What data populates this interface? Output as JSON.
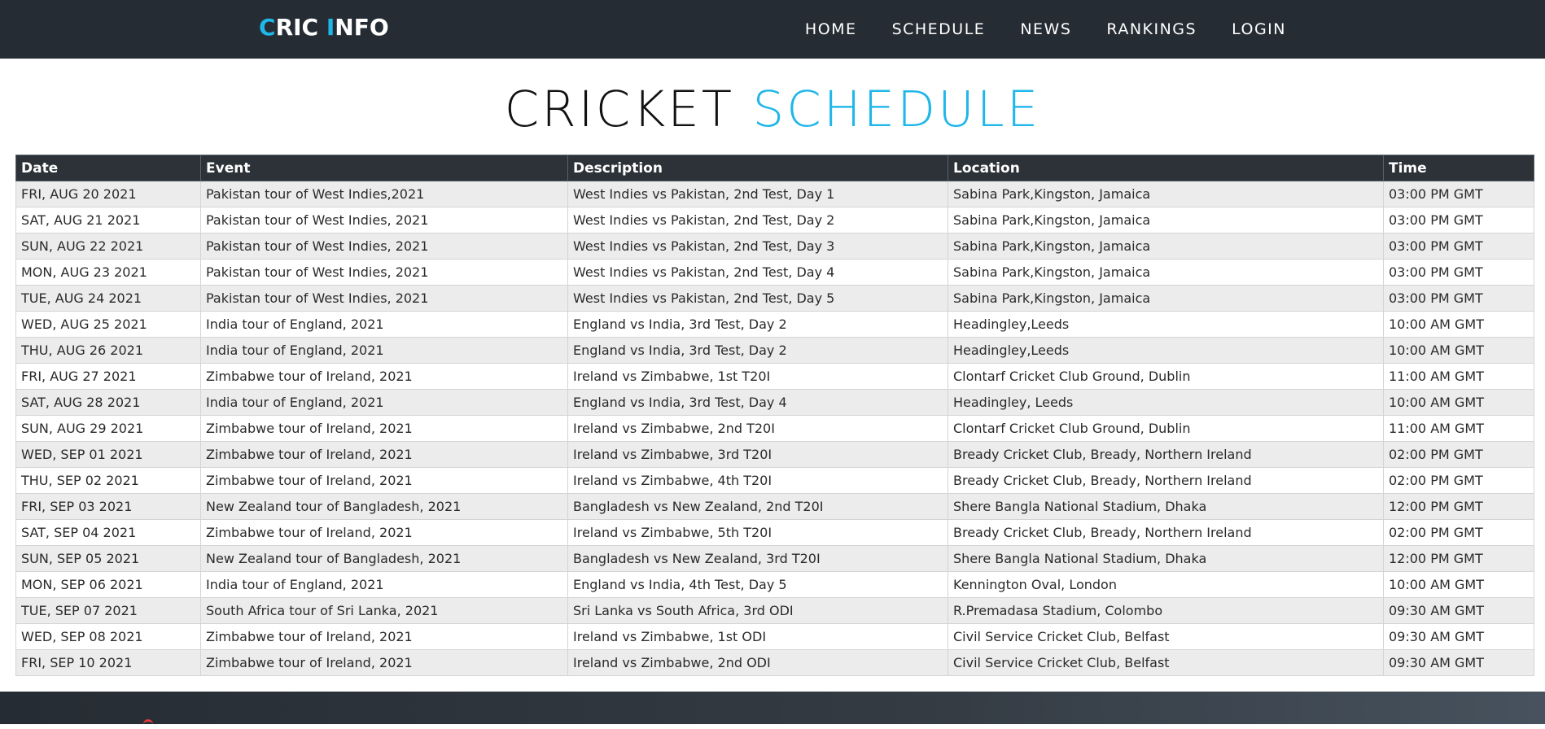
{
  "brand": {
    "part1_accent": "C",
    "part1_rest": "RIC ",
    "part2_accent": "I",
    "part2_rest": "NFO"
  },
  "nav": {
    "items": [
      {
        "label": "HOME"
      },
      {
        "label": "SCHEDULE"
      },
      {
        "label": "NEWS"
      },
      {
        "label": "RANKINGS"
      },
      {
        "label": "LOGIN"
      }
    ]
  },
  "page": {
    "title_part1": "CRICKET",
    "title_part2": "SCHEDULE"
  },
  "table": {
    "headers": [
      "Date",
      "Event",
      "Description",
      "Location",
      "Time"
    ],
    "rows": [
      [
        "FRI, AUG 20 2021",
        "Pakistan tour of West Indies,2021",
        "West Indies vs Pakistan, 2nd Test, Day 1",
        "Sabina Park,Kingston, Jamaica",
        "03:00 PM GMT"
      ],
      [
        "SAT, AUG 21 2021",
        "Pakistan tour of West Indies, 2021",
        "West Indies vs Pakistan, 2nd Test, Day 2",
        "Sabina Park,Kingston, Jamaica",
        "03:00 PM GMT"
      ],
      [
        "SUN, AUG 22 2021",
        "Pakistan tour of West Indies, 2021",
        "West Indies vs Pakistan, 2nd Test, Day 3",
        "Sabina Park,Kingston, Jamaica",
        "03:00 PM GMT"
      ],
      [
        "MON, AUG 23 2021",
        "Pakistan tour of West Indies, 2021",
        "West Indies vs Pakistan, 2nd Test, Day 4",
        "Sabina Park,Kingston, Jamaica",
        "03:00 PM GMT"
      ],
      [
        "TUE, AUG 24 2021",
        "Pakistan tour of West Indies, 2021",
        "West Indies vs Pakistan, 2nd Test, Day 5",
        "Sabina Park,Kingston, Jamaica",
        "03:00 PM GMT"
      ],
      [
        "WED, AUG 25 2021",
        "India tour of England, 2021",
        "England vs India, 3rd Test, Day 2",
        "Headingley,Leeds",
        "10:00 AM GMT"
      ],
      [
        "THU, AUG 26 2021",
        "India tour of England, 2021",
        "England vs India, 3rd Test, Day 2",
        "Headingley,Leeds",
        "10:00 AM GMT"
      ],
      [
        "FRI, AUG 27 2021",
        "Zimbabwe tour of Ireland, 2021",
        "Ireland vs Zimbabwe, 1st T20I",
        "Clontarf Cricket Club Ground, Dublin",
        "11:00 AM GMT"
      ],
      [
        "SAT, AUG 28 2021",
        "India tour of England, 2021",
        "England vs India, 3rd Test, Day 4",
        "Headingley, Leeds",
        "10:00 AM GMT"
      ],
      [
        "SUN, AUG 29 2021",
        "Zimbabwe tour of Ireland, 2021",
        "Ireland vs Zimbabwe, 2nd T20I",
        "Clontarf Cricket Club Ground, Dublin",
        "11:00 AM GMT"
      ],
      [
        "WED, SEP 01 2021",
        "Zimbabwe tour of Ireland, 2021",
        "Ireland vs Zimbabwe, 3rd T20I",
        "Bready Cricket Club, Bready, Northern Ireland",
        "02:00 PM GMT"
      ],
      [
        "THU, SEP 02 2021",
        "Zimbabwe tour of Ireland, 2021",
        "Ireland vs Zimbabwe, 4th T20I",
        "Bready Cricket Club, Bready, Northern Ireland",
        "02:00 PM GMT"
      ],
      [
        "FRI, SEP 03 2021",
        "New Zealand tour of Bangladesh, 2021",
        "Bangladesh vs New Zealand, 2nd T20I",
        "Shere Bangla National Stadium, Dhaka",
        "12:00 PM GMT"
      ],
      [
        "SAT, SEP 04 2021",
        "Zimbabwe tour of Ireland, 2021",
        "Ireland vs Zimbabwe, 5th T20I",
        "Bready Cricket Club, Bready, Northern Ireland",
        "02:00 PM GMT"
      ],
      [
        "SUN, SEP 05 2021",
        "New Zealand tour of Bangladesh, 2021",
        "Bangladesh vs New Zealand, 3rd T20I",
        "Shere Bangla National Stadium, Dhaka",
        "12:00 PM GMT"
      ],
      [
        "MON, SEP 06 2021",
        "India tour of England, 2021",
        "England vs India, 4th Test, Day 5",
        "Kennington Oval, London",
        "10:00 AM GMT"
      ],
      [
        "TUE, SEP 07 2021",
        "South Africa tour of Sri Lanka, 2021",
        "Sri Lanka vs South Africa, 3rd ODI",
        "R.Premadasa Stadium, Colombo",
        "09:30 AM GMT"
      ],
      [
        "WED, SEP 08 2021",
        "Zimbabwe tour of Ireland, 2021",
        "Ireland vs Zimbabwe, 1st ODI",
        "Civil Service Cricket Club, Belfast",
        "09:30 AM GMT"
      ],
      [
        "FRI, SEP 10 2021",
        "Zimbabwe tour of Ireland, 2021",
        "Ireland vs Zimbabwe, 2nd ODI",
        "Civil Service Cricket Club, Belfast",
        "09:30 AM GMT"
      ]
    ]
  },
  "colors": {
    "accent": "#1fb6e8",
    "navbar": "#262c33",
    "row_alt": "#ececec",
    "footer_mark": "#e53935"
  },
  "icons": {
    "footer_mark": "logo-fragment-icon"
  }
}
